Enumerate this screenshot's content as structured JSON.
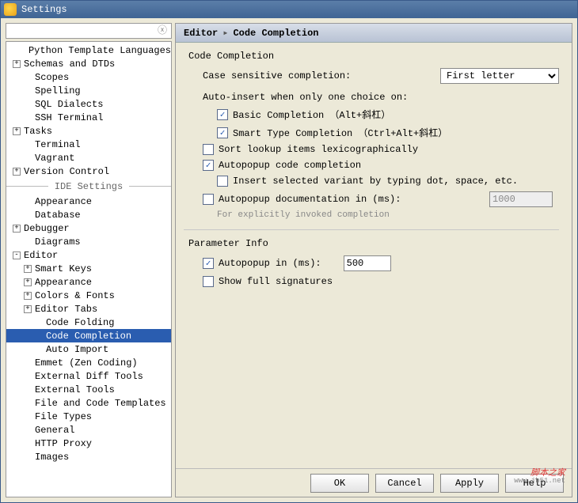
{
  "title": "Settings",
  "tree": {
    "top": [
      {
        "label": "Python Template Languages",
        "indent": 22,
        "tog": null
      },
      {
        "label": "Schemas and DTDs",
        "indent": 8,
        "tog": "+"
      },
      {
        "label": "Scopes",
        "indent": 22,
        "tog": null
      },
      {
        "label": "Spelling",
        "indent": 22,
        "tog": null
      },
      {
        "label": "SQL Dialects",
        "indent": 22,
        "tog": null
      },
      {
        "label": "SSH Terminal",
        "indent": 22,
        "tog": null
      },
      {
        "label": "Tasks",
        "indent": 8,
        "tog": "+"
      },
      {
        "label": "Terminal",
        "indent": 22,
        "tog": null
      },
      {
        "label": "Vagrant",
        "indent": 22,
        "tog": null
      },
      {
        "label": "Version Control",
        "indent": 8,
        "tog": "+"
      }
    ],
    "sep": "IDE Settings",
    "bottom": [
      {
        "label": "Appearance",
        "indent": 22,
        "tog": null
      },
      {
        "label": "Database",
        "indent": 22,
        "tog": null
      },
      {
        "label": "Debugger",
        "indent": 8,
        "tog": "+"
      },
      {
        "label": "Diagrams",
        "indent": 22,
        "tog": null
      },
      {
        "label": "Editor",
        "indent": 8,
        "tog": "-"
      },
      {
        "label": "Smart Keys",
        "indent": 22,
        "tog": "+"
      },
      {
        "label": "Appearance",
        "indent": 22,
        "tog": "+"
      },
      {
        "label": "Colors & Fonts",
        "indent": 22,
        "tog": "+"
      },
      {
        "label": "Editor Tabs",
        "indent": 22,
        "tog": "+"
      },
      {
        "label": "Code Folding",
        "indent": 36,
        "tog": null
      },
      {
        "label": "Code Completion",
        "indent": 36,
        "tog": null,
        "sel": true
      },
      {
        "label": "Auto Import",
        "indent": 36,
        "tog": null
      },
      {
        "label": "Emmet (Zen Coding)",
        "indent": 22,
        "tog": null
      },
      {
        "label": "External Diff Tools",
        "indent": 22,
        "tog": null
      },
      {
        "label": "External Tools",
        "indent": 22,
        "tog": null
      },
      {
        "label": "File and Code Templates",
        "indent": 22,
        "tog": null
      },
      {
        "label": "File Types",
        "indent": 22,
        "tog": null
      },
      {
        "label": "General",
        "indent": 22,
        "tog": null
      },
      {
        "label": "HTTP Proxy",
        "indent": 22,
        "tog": null
      },
      {
        "label": "Images",
        "indent": 22,
        "tog": null
      }
    ]
  },
  "breadcrumb": {
    "a": "Editor",
    "b": "Code Completion"
  },
  "section1": {
    "title": "Code Completion",
    "caseLabel": "Case sensitive completion:",
    "caseValue": "First letter",
    "autoInsertLabel": "Auto-insert when only one choice on:",
    "basic": {
      "checked": true,
      "label": "Basic Completion （Alt+斜杠）"
    },
    "smart": {
      "checked": true,
      "label": "Smart Type Completion （Ctrl+Alt+斜杠）"
    },
    "sortLookup": {
      "checked": false,
      "label": "Sort lookup items lexicographically"
    },
    "autopopCode": {
      "checked": true,
      "label": "Autopopup code completion"
    },
    "insertVariant": {
      "checked": false,
      "label": "Insert selected variant by typing dot, space, etc."
    },
    "autopopDoc": {
      "checked": false,
      "label": "Autopopup documentation in (ms):",
      "value": "1000",
      "sub": "For explicitly invoked completion"
    }
  },
  "section2": {
    "title": "Parameter Info",
    "autopopIn": {
      "checked": true,
      "label": "Autopopup in (ms):",
      "value": "500"
    },
    "showFull": {
      "checked": false,
      "label": "Show full signatures"
    }
  },
  "buttons": {
    "ok": "OK",
    "cancel": "Cancel",
    "apply": "Apply",
    "help": "Help"
  },
  "watermark": {
    "a": "脚本之家",
    "b": "www.jb51.net"
  }
}
